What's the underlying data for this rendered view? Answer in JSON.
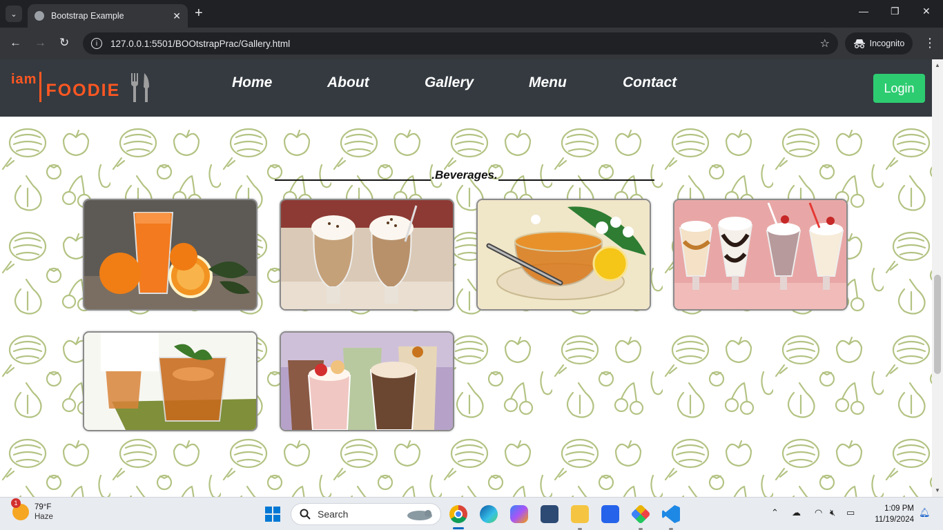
{
  "browser": {
    "tab_title": "Bootstrap Example",
    "url": "127.0.0.1:5501/BOOtstrapPrac/Gallery.html",
    "incognito_label": "Incognito"
  },
  "site": {
    "logo_iam": "iam",
    "logo_foodie": "FOODIE",
    "nav": {
      "home": "Home",
      "about": "About",
      "gallery": "Gallery",
      "menu": "Menu",
      "contact": "Contact"
    },
    "login_label": "Login",
    "section_heading": ".Beverages.",
    "gallery_items": [
      {
        "subject": "orange juice"
      },
      {
        "subject": "coffee frappe"
      },
      {
        "subject": "lemon tea"
      },
      {
        "subject": "milkshakes"
      },
      {
        "subject": "iced tea"
      },
      {
        "subject": "smoothies"
      }
    ]
  },
  "taskbar": {
    "weather_badge": "1",
    "temperature": "79°F",
    "condition": "Haze",
    "search_placeholder": "Search",
    "time": "1:09 PM",
    "date": "11/19/2024"
  },
  "colors": {
    "brand_orange": "#ff5722",
    "login_green": "#2ecc71",
    "navbar_bg": "#343a40",
    "pattern_green": "#b3c383"
  }
}
